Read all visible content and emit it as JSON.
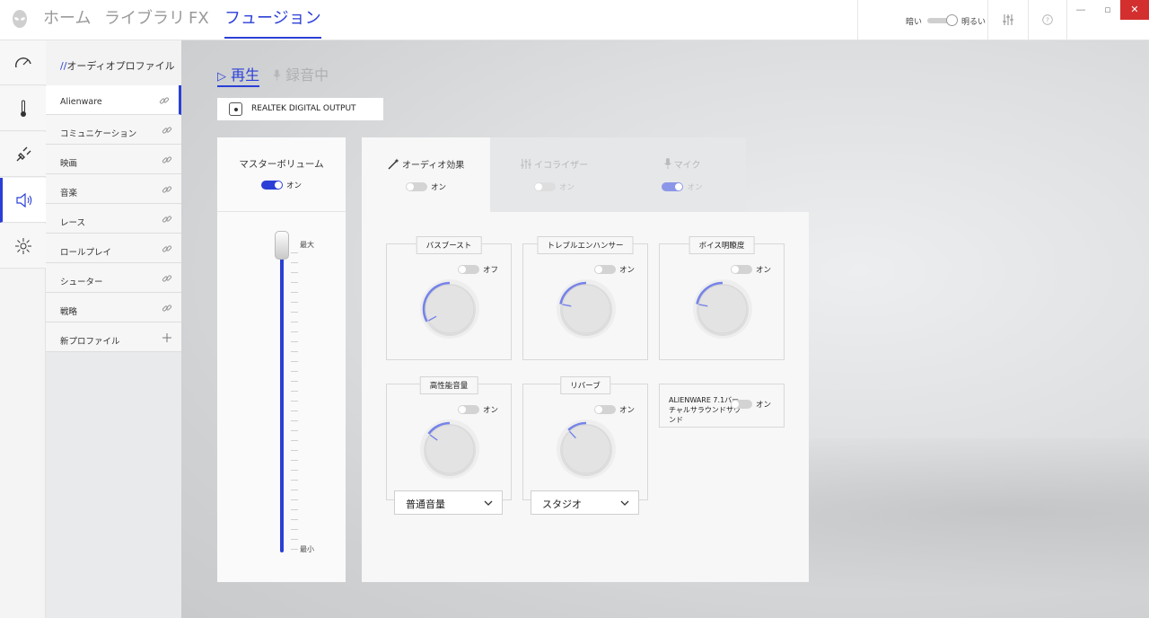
{
  "topbar": {
    "nav": [
      "ホーム",
      "ライブラリ",
      "FX",
      "フュージョン"
    ],
    "active_nav": "フュージョン",
    "brightness": {
      "dark_label": "暗い",
      "bright_label": "明るい",
      "level": 1.0
    },
    "window_buttons": [
      "—",
      "▫",
      "✕"
    ]
  },
  "rail": {
    "icons": [
      "performance-icon",
      "thermal-icon",
      "power-icon",
      "audio-icon",
      "lighting-icon"
    ],
    "active": "audio-icon"
  },
  "profiles": {
    "prefix": "//",
    "title": "オーディオプロファイル",
    "items": [
      {
        "label": "Alienware",
        "icon": "link-icon"
      },
      {
        "label": "コミュニケーション",
        "icon": "link-icon"
      },
      {
        "label": "映画",
        "icon": "link-icon"
      },
      {
        "label": "音楽",
        "icon": "link-icon"
      },
      {
        "label": "レース",
        "icon": "link-icon"
      },
      {
        "label": "ロールプレイ",
        "icon": "link-icon"
      },
      {
        "label": "シューター",
        "icon": "link-icon"
      },
      {
        "label": "戦略",
        "icon": "link-icon"
      },
      {
        "label": "新プロファイル",
        "icon": "plus-icon"
      }
    ]
  },
  "mode_tabs": {
    "playback": "再生",
    "recording": "録音中",
    "playback_glyph": "▷"
  },
  "device": {
    "name": "REALTEK DIGITAL OUTPUT"
  },
  "master": {
    "title": "マスターボリューム",
    "toggle_label": "オン",
    "toggle_on": true,
    "max_label": "最大",
    "min_label": "最小",
    "volume": 1.0
  },
  "effect_tabs": [
    {
      "label": "オーディオ効果",
      "toggle_label": "オン",
      "icon": "wand-icon"
    },
    {
      "label": "イコライザー",
      "toggle_label": "オン",
      "icon": "equalizer-icon"
    },
    {
      "label": "マイク",
      "toggle_label": "オン",
      "icon": "microphone-icon"
    }
  ],
  "effects": {
    "bass_boost": {
      "title": "バスブースト",
      "toggle_label": "オフ",
      "level": 0.33
    },
    "treble": {
      "title": "トレブルエンハンサー",
      "toggle_label": "オン",
      "level": 0.22
    },
    "voice": {
      "title": "ボイス明瞭度",
      "toggle_label": "オン",
      "level": 0.22
    },
    "loudness": {
      "title": "高性能音量",
      "toggle_label": "オン",
      "level": 0.15,
      "dropdown": "普通音量"
    },
    "reverb": {
      "title": "リバーブ",
      "toggle_label": "オン",
      "level": 0.12,
      "dropdown": "スタジオ"
    },
    "virtual_surround": {
      "title": "ALIENWARE 7.1バーチャルサラウンドサウンド",
      "toggle_label": "オン"
    }
  },
  "colors": {
    "accent": "#2b3fd6",
    "knob_arc": "#7683e8",
    "close": "#d32f2f"
  }
}
